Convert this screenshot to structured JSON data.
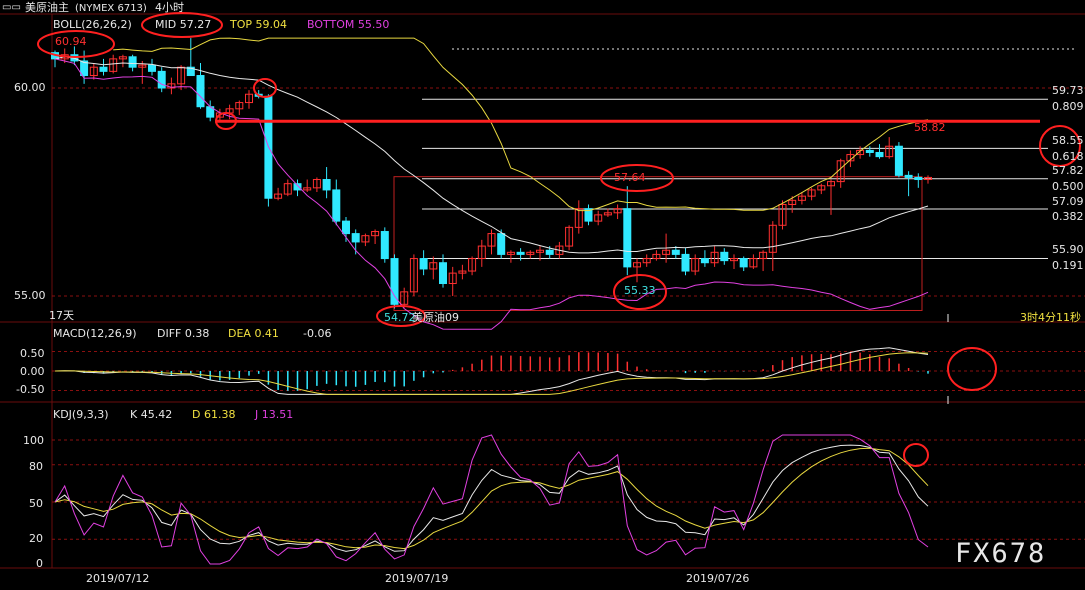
{
  "header": {
    "symbol": "美原油主",
    "exchange_code": "(NYMEX 6713)",
    "period": "4小时"
  },
  "boll": {
    "label": "BOLL(26,26,2)",
    "mid": "MID 57.27",
    "top": "TOP 59.04",
    "bottom": "BOTTOM 55.50"
  },
  "macd": {
    "label": "MACD(12,26,9)",
    "diff": "DIFF 0.38",
    "dea": "DEA 0.41",
    "value": "-0.06"
  },
  "kdj": {
    "label": "KDJ(9,3,3)",
    "k": "K 45.42",
    "d": "D 61.38",
    "j": "J 13.51"
  },
  "axis": {
    "price_ticks": [
      "60.00",
      "55.00"
    ],
    "macd_ticks": [
      "0.50",
      "0.00",
      "-0.50"
    ],
    "kdj_ticks": [
      "100",
      "80",
      "50",
      "20",
      "0"
    ],
    "dates": [
      "2019/07/12",
      "2019/07/19",
      "2019/07/26"
    ],
    "days_label": "17天",
    "countdown": "3时4分11秒",
    "overlay_label": "美原油09"
  },
  "levels": [
    {
      "price": "59.73",
      "ratio": "0.809"
    },
    {
      "price": "58.55",
      "ratio": "0.618"
    },
    {
      "price": "57.82",
      "ratio": "0.500"
    },
    {
      "price": "57.09",
      "ratio": "0.382"
    },
    {
      "price": "55.90",
      "ratio": "0.191"
    }
  ],
  "annotations": {
    "high_left": "60.94",
    "mid_high": "57.64",
    "right_high": "58.82",
    "low_left": "54.72",
    "mid_low": "55.33"
  },
  "watermark": "FX678",
  "colors": {
    "up": "#ff3030",
    "down": "#30e8ff",
    "mid_line": "#e8e8e8",
    "top_line": "#e8d840",
    "bottom_line": "#e040e0",
    "resistance": "#ff2020",
    "grid": "#8a1010"
  },
  "chart_data": {
    "type": "candlestick",
    "title": "美原油主 (NYMEX 6713) 4小时",
    "price_range": [
      54.55,
      61.5
    ],
    "resistance_level": 59.2,
    "fib_levels": [
      59.73,
      58.55,
      57.82,
      57.09,
      55.9
    ],
    "candles": [
      [
        60.85,
        60.9,
        60.5,
        60.7
      ],
      [
        60.7,
        60.95,
        60.6,
        60.8
      ],
      [
        60.8,
        61.0,
        60.55,
        60.65
      ],
      [
        60.65,
        60.9,
        60.1,
        60.3
      ],
      [
        60.3,
        60.6,
        60.2,
        60.5
      ],
      [
        60.5,
        60.7,
        60.3,
        60.4
      ],
      [
        60.4,
        60.8,
        60.35,
        60.7
      ],
      [
        60.7,
        60.8,
        60.5,
        60.75
      ],
      [
        60.75,
        60.8,
        60.4,
        60.5
      ],
      [
        60.5,
        60.65,
        60.1,
        60.55
      ],
      [
        60.55,
        60.7,
        60.3,
        60.4
      ],
      [
        60.4,
        60.5,
        59.9,
        60.0
      ],
      [
        60.0,
        60.25,
        59.85,
        60.1
      ],
      [
        60.1,
        60.55,
        59.95,
        60.5
      ],
      [
        60.5,
        61.2,
        60.3,
        60.3
      ],
      [
        60.3,
        60.6,
        59.5,
        59.55
      ],
      [
        59.55,
        59.7,
        59.2,
        59.3
      ],
      [
        59.3,
        59.5,
        59.2,
        59.4
      ],
      [
        59.4,
        59.6,
        59.25,
        59.5
      ],
      [
        59.5,
        59.7,
        59.35,
        59.65
      ],
      [
        59.65,
        59.95,
        59.5,
        59.85
      ],
      [
        59.85,
        59.95,
        59.75,
        59.8
      ],
      [
        59.8,
        59.85,
        57.15,
        57.35
      ],
      [
        57.35,
        57.6,
        57.3,
        57.45
      ],
      [
        57.45,
        57.8,
        57.4,
        57.7
      ],
      [
        57.7,
        57.8,
        57.4,
        57.55
      ],
      [
        57.55,
        57.8,
        57.5,
        57.6
      ],
      [
        57.6,
        57.85,
        57.5,
        57.8
      ],
      [
        57.8,
        58.1,
        57.35,
        57.55
      ],
      [
        57.55,
        57.8,
        56.7,
        56.8
      ],
      [
        56.8,
        56.9,
        56.3,
        56.5
      ],
      [
        56.5,
        56.6,
        56.0,
        56.3
      ],
      [
        56.3,
        56.5,
        56.2,
        56.45
      ],
      [
        56.45,
        56.6,
        56.25,
        56.55
      ],
      [
        56.55,
        56.65,
        55.8,
        55.9
      ],
      [
        55.9,
        56.0,
        54.7,
        54.8
      ],
      [
        54.8,
        55.2,
        54.72,
        55.1
      ],
      [
        55.1,
        56.0,
        55.0,
        55.9
      ],
      [
        55.9,
        56.1,
        55.5,
        55.65
      ],
      [
        55.65,
        55.95,
        55.4,
        55.8
      ],
      [
        55.8,
        56.0,
        55.2,
        55.3
      ],
      [
        55.3,
        55.7,
        55.0,
        55.55
      ],
      [
        55.55,
        55.75,
        55.4,
        55.6
      ],
      [
        55.6,
        55.95,
        55.5,
        55.9
      ],
      [
        55.9,
        56.35,
        55.7,
        56.2
      ],
      [
        56.2,
        56.6,
        56.0,
        56.5
      ],
      [
        56.5,
        56.6,
        55.9,
        56.0
      ],
      [
        56.0,
        56.1,
        55.8,
        56.05
      ],
      [
        56.05,
        56.15,
        55.85,
        56.0
      ],
      [
        56.0,
        56.1,
        55.9,
        56.05
      ],
      [
        56.05,
        56.2,
        55.85,
        56.1
      ],
      [
        56.1,
        56.2,
        55.9,
        56.0
      ],
      [
        56.0,
        56.3,
        55.9,
        56.2
      ],
      [
        56.2,
        56.7,
        56.1,
        56.65
      ],
      [
        56.65,
        57.3,
        56.5,
        57.1
      ],
      [
        57.1,
        57.2,
        56.7,
        56.8
      ],
      [
        56.8,
        57.05,
        56.7,
        56.95
      ],
      [
        56.95,
        57.1,
        56.9,
        57.0
      ],
      [
        57.0,
        57.2,
        56.85,
        57.1
      ],
      [
        57.1,
        57.64,
        55.5,
        55.7
      ],
      [
        55.7,
        55.9,
        55.33,
        55.8
      ],
      [
        55.8,
        56.0,
        55.7,
        55.9
      ],
      [
        55.9,
        56.1,
        55.85,
        56.0
      ],
      [
        56.0,
        56.5,
        55.8,
        56.1
      ],
      [
        56.1,
        56.2,
        55.9,
        56.0
      ],
      [
        56.0,
        56.15,
        55.5,
        55.6
      ],
      [
        55.6,
        56.0,
        55.5,
        55.9
      ],
      [
        55.9,
        56.1,
        55.7,
        55.8
      ],
      [
        55.8,
        56.2,
        55.7,
        56.05
      ],
      [
        56.05,
        56.15,
        55.75,
        55.85
      ],
      [
        55.85,
        56.0,
        55.65,
        55.9
      ],
      [
        55.9,
        55.95,
        55.6,
        55.7
      ],
      [
        55.7,
        56.0,
        55.65,
        55.9
      ],
      [
        55.9,
        56.1,
        55.6,
        56.05
      ],
      [
        56.05,
        56.8,
        55.6,
        56.7
      ],
      [
        56.7,
        57.3,
        56.6,
        57.2
      ],
      [
        57.2,
        57.4,
        57.0,
        57.3
      ],
      [
        57.3,
        57.5,
        57.2,
        57.4
      ],
      [
        57.4,
        57.6,
        57.3,
        57.55
      ],
      [
        57.55,
        57.7,
        57.45,
        57.65
      ],
      [
        57.65,
        57.8,
        56.95,
        57.75
      ],
      [
        57.75,
        58.3,
        57.6,
        58.25
      ],
      [
        58.25,
        58.5,
        58.1,
        58.4
      ],
      [
        58.4,
        58.6,
        58.3,
        58.5
      ],
      [
        58.5,
        58.6,
        58.35,
        58.45
      ],
      [
        58.45,
        58.65,
        58.3,
        58.35
      ],
      [
        58.35,
        58.82,
        58.3,
        58.6
      ],
      [
        58.6,
        58.7,
        57.85,
        57.9
      ],
      [
        57.9,
        58.0,
        57.4,
        57.85
      ],
      [
        57.85,
        57.95,
        57.6,
        57.8
      ],
      [
        57.8,
        57.9,
        57.7,
        57.85
      ]
    ]
  }
}
